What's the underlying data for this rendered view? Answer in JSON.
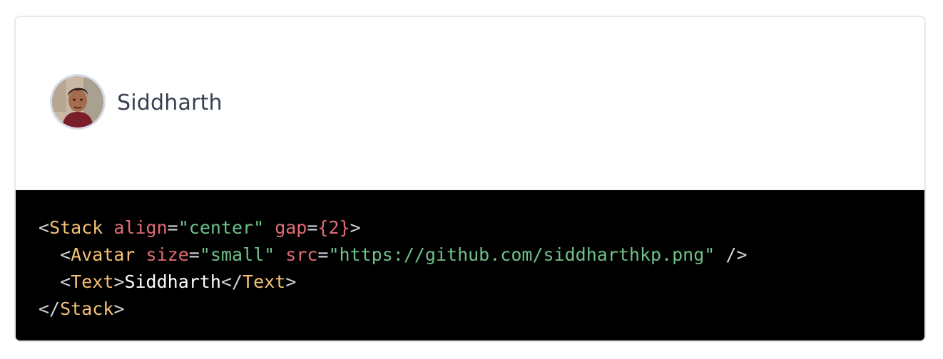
{
  "preview": {
    "name": "Siddharth"
  },
  "code": {
    "line1": {
      "lt": "<",
      "tag": "Stack",
      "sp1": " ",
      "attr1": "align",
      "eq1": "=",
      "val1": "\"center\"",
      "sp2": " ",
      "attr2": "gap",
      "eq2": "=",
      "val2": "{2}",
      "gt": ">"
    },
    "line2": {
      "indent": "  ",
      "lt": "<",
      "tag": "Avatar",
      "sp1": " ",
      "attr1": "size",
      "eq1": "=",
      "val1": "\"small\"",
      "sp2": " ",
      "attr2": "src",
      "eq2": "=",
      "val2": "\"https://github.com/siddharthkp.png\"",
      "close": " />"
    },
    "line3": {
      "indent": "  ",
      "lt1": "<",
      "tag1": "Text",
      "gt1": ">",
      "text": "Siddharth",
      "lt2": "</",
      "tag2": "Text",
      "gt2": ">"
    },
    "line4": {
      "lt": "</",
      "tag": "Stack",
      "gt": ">"
    }
  }
}
